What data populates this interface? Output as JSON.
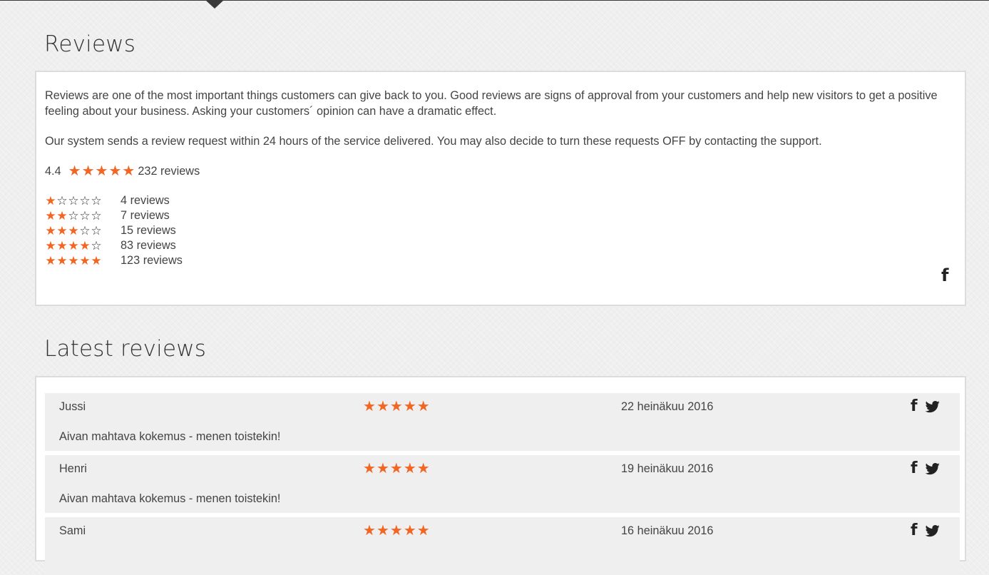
{
  "colors": {
    "accent": "#f26522",
    "panel_border": "#dcdcdc",
    "card_bg": "#efefef"
  },
  "reviews_section": {
    "title": "Reviews",
    "intro_paragraph_1": "Reviews are one of the most important things customers can give back to you. Good reviews are signs of approval from your customers and help new visitors to get a positive feeling about your business. Asking your customers´ opinion can have a dramatic effect.",
    "intro_paragraph_2": "Our system sends a review request within 24 hours of the service delivered. You may also decide to turn these requests OFF by contacting the support.",
    "average_rating": "4.4",
    "average_stars": 5,
    "total_reviews_label": "232 reviews",
    "breakdown": [
      {
        "stars": 1,
        "label": "4 reviews"
      },
      {
        "stars": 2,
        "label": "7 reviews"
      },
      {
        "stars": 3,
        "label": "15 reviews"
      },
      {
        "stars": 4,
        "label": "83 reviews"
      },
      {
        "stars": 5,
        "label": "123 reviews"
      }
    ],
    "share_icon": "facebook-icon"
  },
  "latest_section": {
    "title": "Latest reviews",
    "reviews": [
      {
        "name": "Jussi",
        "stars": 5,
        "date": "22 heinäkuu 2016",
        "text": "Aivan mahtava kokemus - menen toistekin!"
      },
      {
        "name": "Henri",
        "stars": 5,
        "date": "19 heinäkuu 2016",
        "text": "Aivan mahtava kokemus - menen toistekin!"
      },
      {
        "name": "Sami",
        "stars": 5,
        "date": "16 heinäkuu 2016",
        "text": ""
      }
    ],
    "share_icons": [
      "facebook-icon",
      "twitter-icon"
    ]
  }
}
